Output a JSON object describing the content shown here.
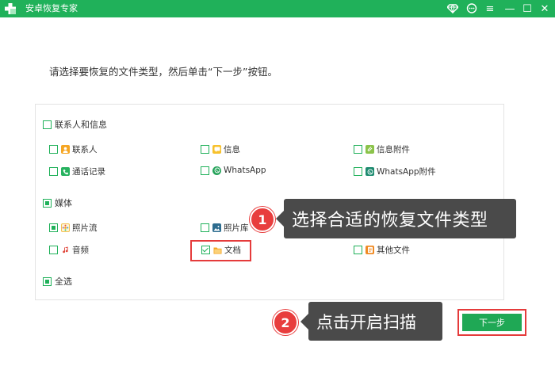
{
  "window": {
    "title": "安卓恢复专家",
    "controls": {
      "diamond": "diamond-icon",
      "chat": "chat-icon",
      "menu": "≡",
      "minimize": "—",
      "maximize": "☐",
      "close": "✕"
    }
  },
  "instruction": "请选择要恢复的文件类型，然后单击“下一步”按钮。",
  "groups": {
    "contacts": {
      "label": "联系人和信息",
      "items": {
        "contacts": "联系人",
        "messages": "信息",
        "attachments": "信息附件",
        "call_logs": "通话记录",
        "whatsapp": "WhatsApp",
        "whatsapp_attachments": "WhatsApp附件"
      }
    },
    "media": {
      "label": "媒体",
      "items": {
        "photo_stream": "照片流",
        "photo_library": "照片库",
        "audio": "音频",
        "documents": "文档",
        "other_files": "其他文件"
      }
    },
    "select_all": "全选"
  },
  "callouts": {
    "step1": {
      "number": "1",
      "text": "选择合适的恢复文件类型"
    },
    "step2": {
      "number": "2",
      "text": "点击开启扫描"
    }
  },
  "next_button": "下一步",
  "colors": {
    "brand_green": "#20b15a",
    "highlight_red": "#e53b3b",
    "callout_bg": "#4a4a4a"
  }
}
